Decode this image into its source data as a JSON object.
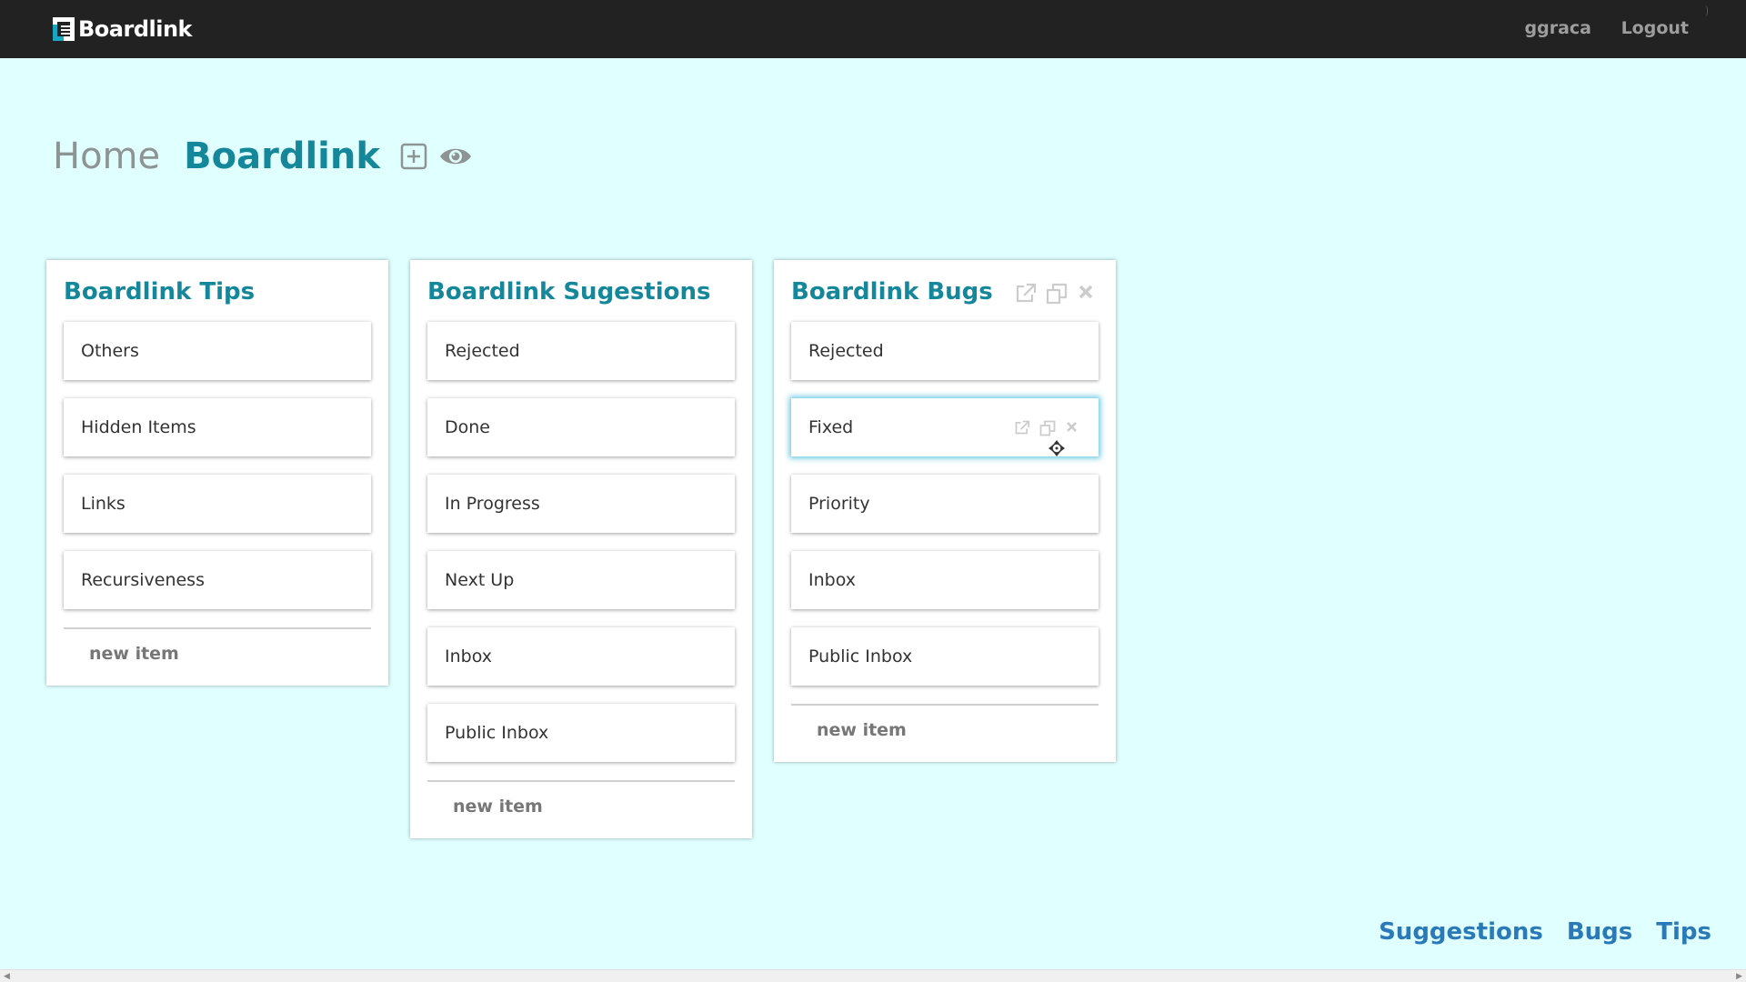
{
  "app": {
    "logo_text": "Boardlink",
    "user": "ggraca",
    "logout_label": "Logout"
  },
  "breadcrumb": {
    "home": "Home",
    "current": "Boardlink",
    "actions": [
      "plus-square-icon",
      "eye-icon"
    ]
  },
  "boards": [
    {
      "title": "Boardlink Tips",
      "items": [
        "Others",
        "Hidden Items",
        "Links",
        "Recursiveness"
      ],
      "new_item_label": "new item"
    },
    {
      "title": "Boardlink Sugestions",
      "items": [
        "Rejected",
        "Done",
        "In Progress",
        "Next Up",
        "Inbox",
        "Public Inbox"
      ],
      "new_item_label": "new item"
    },
    {
      "title": "Boardlink Bugs",
      "items": [
        "Rejected",
        "Fixed",
        "Priority",
        "Inbox",
        "Public Inbox"
      ],
      "new_item_label": "new item",
      "active_item": "Fixed",
      "actions": [
        "external-link-icon",
        "copy-icon",
        "close-icon"
      ]
    }
  ],
  "footer_links": [
    "Suggestions",
    "Bugs",
    "Tips"
  ],
  "colors": {
    "background": "#e0ffff",
    "topbar": "#222222",
    "accent": "#14879b",
    "footer_link": "#2a7ab9"
  }
}
